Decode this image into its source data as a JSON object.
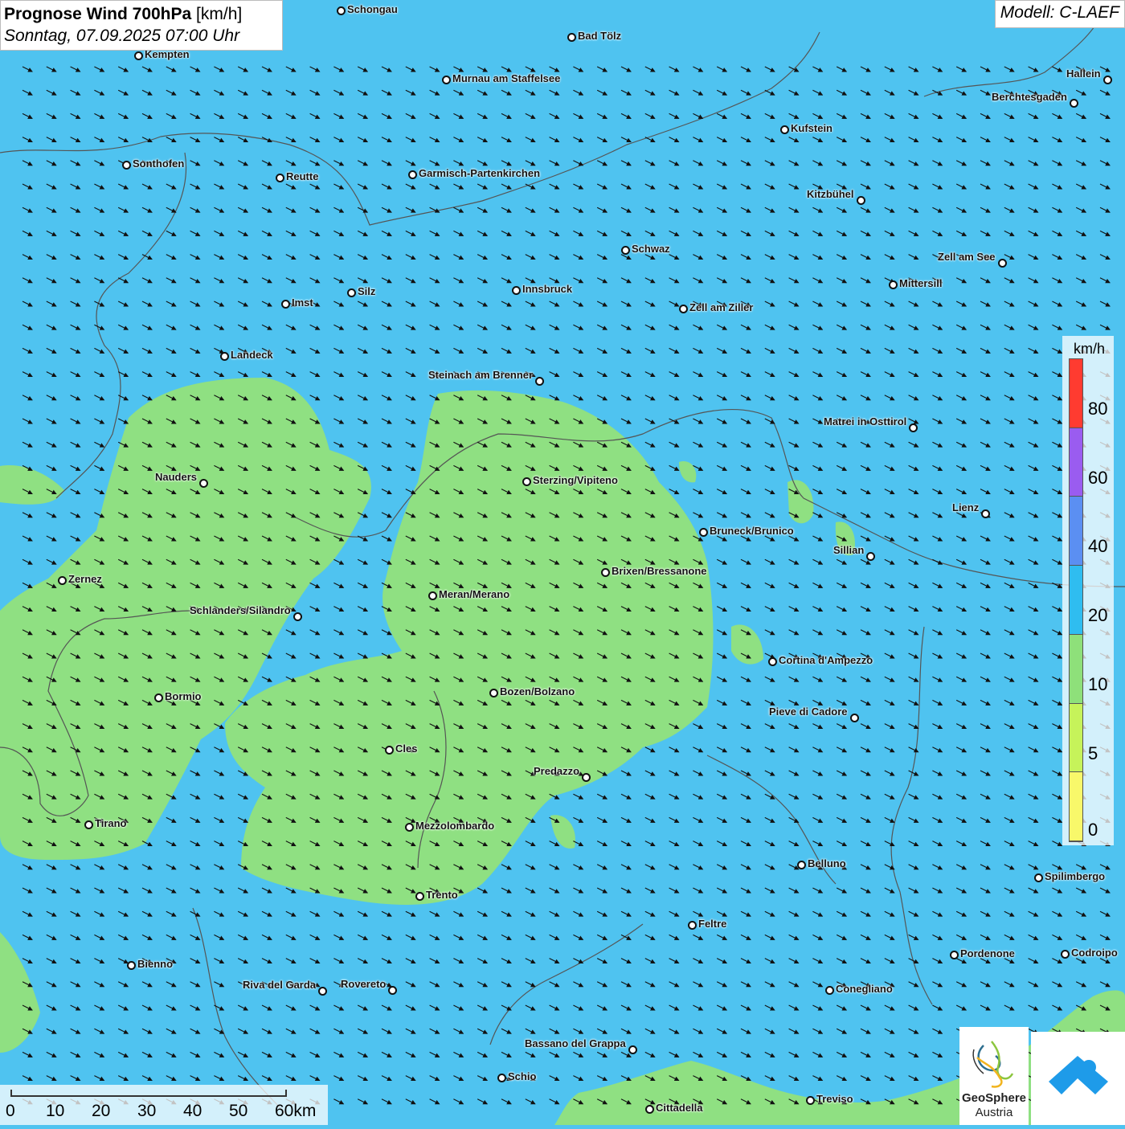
{
  "header": {
    "title_bold": "Prognose Wind 700hPa",
    "title_unit": "[km/h]",
    "datetime": "Sonntag, 07.09.2025 07:00 Uhr"
  },
  "model_label": "Modell: C-LAEF",
  "legend": {
    "unit": "km/h",
    "ticks": [
      "80",
      "60",
      "40",
      "20",
      "10",
      "5",
      "0"
    ],
    "colors": [
      "#ff3b30",
      "#9a5cf0",
      "#5b8ff2",
      "#2fbdf0",
      "#8ee07a",
      "#c6f35a",
      "#f8f86a"
    ]
  },
  "scale_bar": {
    "labels": [
      "0",
      "10",
      "20",
      "30",
      "40",
      "50",
      "60km"
    ]
  },
  "colors": {
    "wind_10_20": "#4fc3f0",
    "wind_5_10": "#8fe082",
    "borders": "#555555",
    "arrows": "#111111"
  },
  "wind": {
    "direction": "from west-northwest toward east-southeast"
  },
  "cities": [
    {
      "name": "Schongau",
      "label_side": "right"
    },
    {
      "name": "Bad Tölz",
      "label_side": "right"
    },
    {
      "name": "Kempten",
      "label_side": "right"
    },
    {
      "name": "Murnau am Staffelsee",
      "label_side": "right"
    },
    {
      "name": "Hallein",
      "label_side": "left"
    },
    {
      "name": "Berchtesgaden",
      "label_side": "left"
    },
    {
      "name": "Kufstein",
      "label_side": "right"
    },
    {
      "name": "Sonthofen",
      "label_side": "right"
    },
    {
      "name": "Reutte",
      "label_side": "right"
    },
    {
      "name": "Garmisch-Partenkirchen",
      "label_side": "right"
    },
    {
      "name": "Kitzbühel",
      "label_side": "left"
    },
    {
      "name": "Schwaz",
      "label_side": "right"
    },
    {
      "name": "Zell am See",
      "label_side": "left"
    },
    {
      "name": "Innsbruck",
      "label_side": "right"
    },
    {
      "name": "Mittersill",
      "label_side": "right"
    },
    {
      "name": "Silz",
      "label_side": "right"
    },
    {
      "name": "Imst",
      "label_side": "right"
    },
    {
      "name": "Zell am Ziller",
      "label_side": "right"
    },
    {
      "name": "Landeck",
      "label_side": "right"
    },
    {
      "name": "Steinach am Brenner",
      "label_side": "left"
    },
    {
      "name": "Matrei in Osttirol",
      "label_side": "left"
    },
    {
      "name": "Nauders",
      "label_side": "left"
    },
    {
      "name": "Sterzing/Vipiteno",
      "label_side": "right"
    },
    {
      "name": "Lienz",
      "label_side": "left"
    },
    {
      "name": "Bruneck/Brunico",
      "label_side": "right"
    },
    {
      "name": "Sillian",
      "label_side": "left"
    },
    {
      "name": "Brixen/Bressanone",
      "label_side": "right"
    },
    {
      "name": "Zernez",
      "label_side": "right"
    },
    {
      "name": "Meran/Merano",
      "label_side": "right"
    },
    {
      "name": "Schlanders/Silandro",
      "label_side": "left"
    },
    {
      "name": "Cortina d'Ampezzo",
      "label_side": "right"
    },
    {
      "name": "Bozen/Bolzano",
      "label_side": "right"
    },
    {
      "name": "Bormio",
      "label_side": "right"
    },
    {
      "name": "Pieve di Cadore",
      "label_side": "left"
    },
    {
      "name": "Cles",
      "label_side": "right"
    },
    {
      "name": "Predazzo",
      "label_side": "left"
    },
    {
      "name": "Tirano",
      "label_side": "right"
    },
    {
      "name": "Mezzolombardo",
      "label_side": "right"
    },
    {
      "name": "Belluno",
      "label_side": "right"
    },
    {
      "name": "Spilimbergo",
      "label_side": "right"
    },
    {
      "name": "Trento",
      "label_side": "right"
    },
    {
      "name": "Feltre",
      "label_side": "right"
    },
    {
      "name": "Pordenone",
      "label_side": "right"
    },
    {
      "name": "Codroipo",
      "label_side": "right"
    },
    {
      "name": "Bienno",
      "label_side": "right"
    },
    {
      "name": "Riva del Garda",
      "label_side": "left"
    },
    {
      "name": "Rovereto",
      "label_side": "left"
    },
    {
      "name": "Conegliano",
      "label_side": "right"
    },
    {
      "name": "Bassano del Grappa",
      "label_side": "left"
    },
    {
      "name": "Schio",
      "label_side": "right"
    },
    {
      "name": "Treviso",
      "label_side": "right"
    },
    {
      "name": "Cittadella",
      "label_side": "right"
    }
  ],
  "logos": {
    "geosphere_line1": "GeoSphere",
    "geosphere_line2": "Austria"
  }
}
